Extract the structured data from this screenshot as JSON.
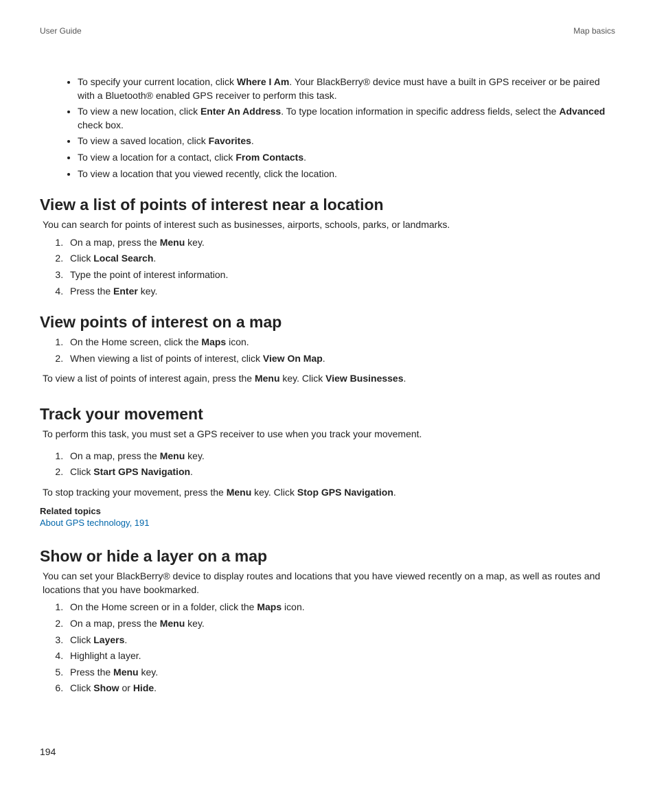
{
  "header": {
    "left": "User Guide",
    "right": "Map basics"
  },
  "topBullets": [
    {
      "pre": "To specify your current location, click ",
      "b1": "Where I Am",
      "post1": ". Your BlackBerry® device must have a built in GPS receiver or be paired with a Bluetooth® enabled GPS receiver to perform this task."
    },
    {
      "pre": "To view a new location, click ",
      "b1": "Enter An Address",
      "post1": ". To type location information in specific address fields, select the ",
      "b2": "Advanced",
      "post2": " check box."
    },
    {
      "pre": "To view a saved location, click ",
      "b1": "Favorites",
      "post1": "."
    },
    {
      "pre": "To view a location for a contact, click ",
      "b1": "From Contacts",
      "post1": "."
    },
    {
      "pre": "To view a location that you viewed recently, click the location.",
      "b1": "",
      "post1": ""
    }
  ],
  "section1": {
    "title": "View a list of points of interest near a location",
    "intro": "You can search for points of interest such as businesses, airports, schools, parks, or landmarks.",
    "steps": [
      {
        "pre": "On a map, press the ",
        "b": "Menu",
        "post": " key."
      },
      {
        "pre": "Click ",
        "b": "Local Search",
        "post": "."
      },
      {
        "pre": "Type the point of interest information.",
        "b": "",
        "post": ""
      },
      {
        "pre": "Press the ",
        "b": "Enter",
        "post": " key."
      }
    ]
  },
  "section2": {
    "title": "View points of interest on a map",
    "steps": [
      {
        "pre": "On the Home screen, click the ",
        "b": "Maps",
        "post": " icon."
      },
      {
        "pre": "When viewing a list of points of interest, click ",
        "b": "View On Map",
        "post": "."
      }
    ],
    "outro_pre": "To view a list of points of interest again, press the ",
    "outro_b1": "Menu",
    "outro_mid": " key. Click ",
    "outro_b2": "View Businesses",
    "outro_post": "."
  },
  "section3": {
    "title": "Track your movement",
    "intro": "To perform this task, you must set a GPS receiver to use when you track your movement.",
    "steps": [
      {
        "pre": "On a map, press the ",
        "b": "Menu",
        "post": " key."
      },
      {
        "pre": "Click ",
        "b": "Start GPS Navigation",
        "post": "."
      }
    ],
    "outro_pre": "To stop tracking your movement, press the ",
    "outro_b1": "Menu",
    "outro_mid": " key. Click ",
    "outro_b2": "Stop GPS Navigation",
    "outro_post": ".",
    "related_heading": "Related topics",
    "related_link": "About GPS technology, 191"
  },
  "section4": {
    "title": "Show or hide a layer on a map",
    "intro": "You can set your BlackBerry® device to display routes and locations that you have viewed recently on a map, as well as routes and locations that you have bookmarked.",
    "steps": [
      {
        "pre": "On the Home screen or in a folder, click the ",
        "b": "Maps",
        "post": " icon."
      },
      {
        "pre": "On a map, press the ",
        "b": "Menu",
        "post": " key."
      },
      {
        "pre": "Click ",
        "b": "Layers",
        "post": "."
      },
      {
        "pre": "Highlight a layer.",
        "b": "",
        "post": ""
      },
      {
        "pre": "Press the ",
        "b": "Menu",
        "post": " key."
      },
      {
        "pre": "Click ",
        "b": "Show",
        "post": " or ",
        "b2": "Hide",
        "post2": "."
      }
    ]
  },
  "pageNumber": "194"
}
